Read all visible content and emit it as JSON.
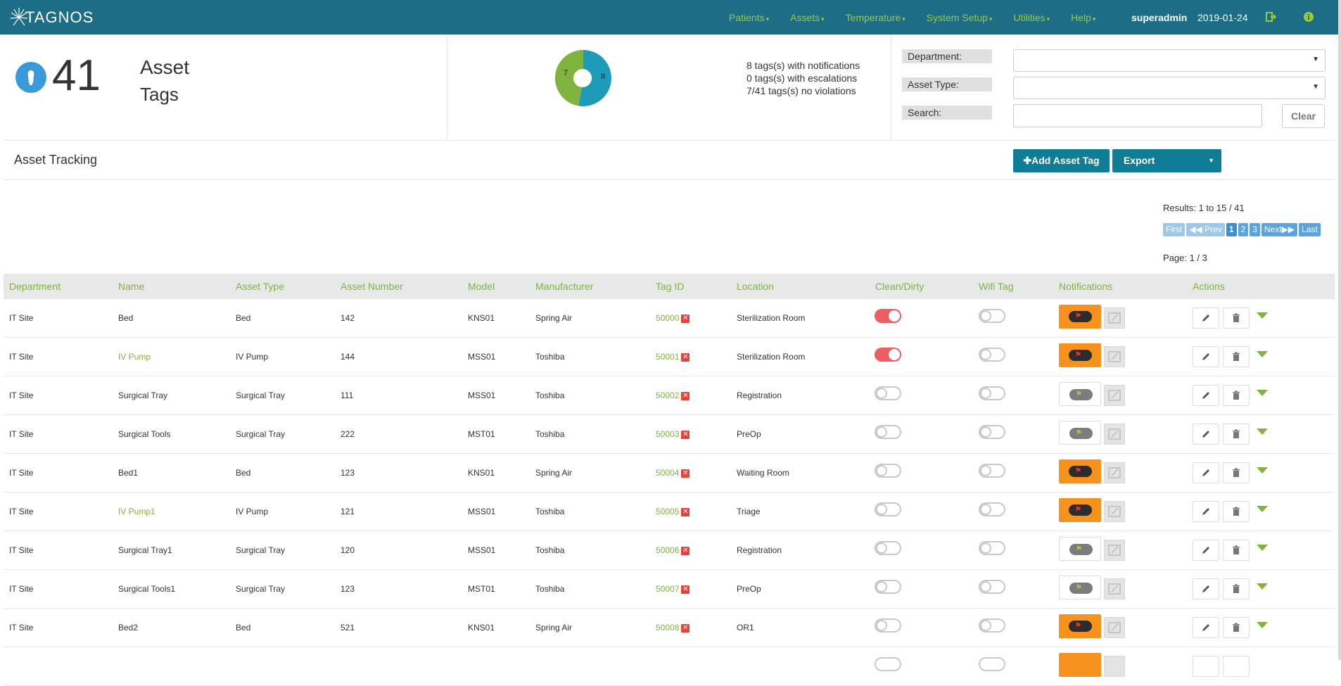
{
  "navbar": {
    "logo": "TAGNOS",
    "menu": [
      "Patients",
      "Assets",
      "Temperature",
      "System Setup",
      "Utilities",
      "Help"
    ],
    "user": "superadmin",
    "date": "2019-01-24",
    "bg_color": "#1d6d86",
    "menu_color": "#9bc93e"
  },
  "summary": {
    "count": "41",
    "label_line1": "Asset",
    "label_line2": "Tags",
    "pie": {
      "value_a": "7",
      "value_b": "8"
    },
    "stats": [
      "8 tags(s) with notifications",
      "0 tags(s) with escalations",
      "7/41 tags(s) no violations"
    ]
  },
  "filters": {
    "department_label": "Department:",
    "asset_type_label": "Asset Type:",
    "search_label": "Search:",
    "clear_label": "Clear"
  },
  "toolbar": {
    "title": "Asset Tracking",
    "add_label": "Add Asset Tag",
    "export_label": "Export"
  },
  "pagination": {
    "results": "Results: 1 to 15 / 41",
    "first": "First",
    "prev": "Prev",
    "pages": [
      "1",
      "2",
      "3"
    ],
    "next": "Next",
    "last": "Last",
    "page_info": "Page: 1 / 3"
  },
  "table": {
    "headers": [
      "Department",
      "Name",
      "Asset Type",
      "Asset Number",
      "Model",
      "Manufacturer",
      "Tag ID",
      "Location",
      "Clean/Dirty",
      "Wifi Tag",
      "Notifications",
      "Actions"
    ],
    "rows": [
      {
        "department": "IT Site",
        "name": "Bed",
        "name_link": false,
        "asset_type": "Bed",
        "asset_number": "142",
        "model": "KNS01",
        "manufacturer": "Spring Air",
        "tag_id": "50000",
        "location": "Sterilization Room",
        "clean": true,
        "wifi": false,
        "alert": true
      },
      {
        "department": "IT Site",
        "name": "IV Pump",
        "name_link": true,
        "asset_type": "IV Pump",
        "asset_number": "144",
        "model": "MSS01",
        "manufacturer": "Toshiba",
        "tag_id": "50001",
        "location": "Sterilization Room",
        "clean": true,
        "wifi": false,
        "alert": true
      },
      {
        "department": "IT Site",
        "name": "Surgical Tray",
        "name_link": false,
        "asset_type": "Surgical Tray",
        "asset_number": "111",
        "model": "MSS01",
        "manufacturer": "Toshiba",
        "tag_id": "50002",
        "location": "Registration",
        "clean": false,
        "wifi": false,
        "alert": false
      },
      {
        "department": "IT Site",
        "name": "Surgical Tools",
        "name_link": false,
        "asset_type": "Surgical Tray",
        "asset_number": "222",
        "model": "MST01",
        "manufacturer": "Toshiba",
        "tag_id": "50003",
        "location": "PreOp",
        "clean": false,
        "wifi": false,
        "alert": false
      },
      {
        "department": "IT Site",
        "name": "Bed1",
        "name_link": false,
        "asset_type": "Bed",
        "asset_number": "123",
        "model": "KNS01",
        "manufacturer": "Spring Air",
        "tag_id": "50004",
        "location": "Waiting Room",
        "clean": false,
        "wifi": false,
        "alert": true
      },
      {
        "department": "IT Site",
        "name": "IV Pump1",
        "name_link": true,
        "asset_type": "IV Pump",
        "asset_number": "121",
        "model": "MSS01",
        "manufacturer": "Toshiba",
        "tag_id": "50005",
        "location": "Triage",
        "clean": false,
        "wifi": false,
        "alert": true
      },
      {
        "department": "IT Site",
        "name": "Surgical Tray1",
        "name_link": false,
        "asset_type": "Surgical Tray",
        "asset_number": "120",
        "model": "MSS01",
        "manufacturer": "Toshiba",
        "tag_id": "50006",
        "location": "Registration",
        "clean": false,
        "wifi": false,
        "alert": false
      },
      {
        "department": "IT Site",
        "name": "Surgical Tools1",
        "name_link": false,
        "asset_type": "Surgical Tray",
        "asset_number": "123",
        "model": "MST01",
        "manufacturer": "Toshiba",
        "tag_id": "50007",
        "location": "PreOp",
        "clean": false,
        "wifi": false,
        "alert": false
      },
      {
        "department": "IT Site",
        "name": "Bed2",
        "name_link": false,
        "asset_type": "Bed",
        "asset_number": "521",
        "model": "KNS01",
        "manufacturer": "Spring Air",
        "tag_id": "50008",
        "location": "OR1",
        "clean": false,
        "wifi": false,
        "alert": true
      }
    ]
  },
  "colors": {
    "accent_green": "#7fb33d",
    "primary_teal": "#0f7d96",
    "alert_orange": "#f7921e",
    "toggle_on": "#ec5e60",
    "pie_blue": "#1e9bb8",
    "pie_green": "#7fb33d"
  }
}
